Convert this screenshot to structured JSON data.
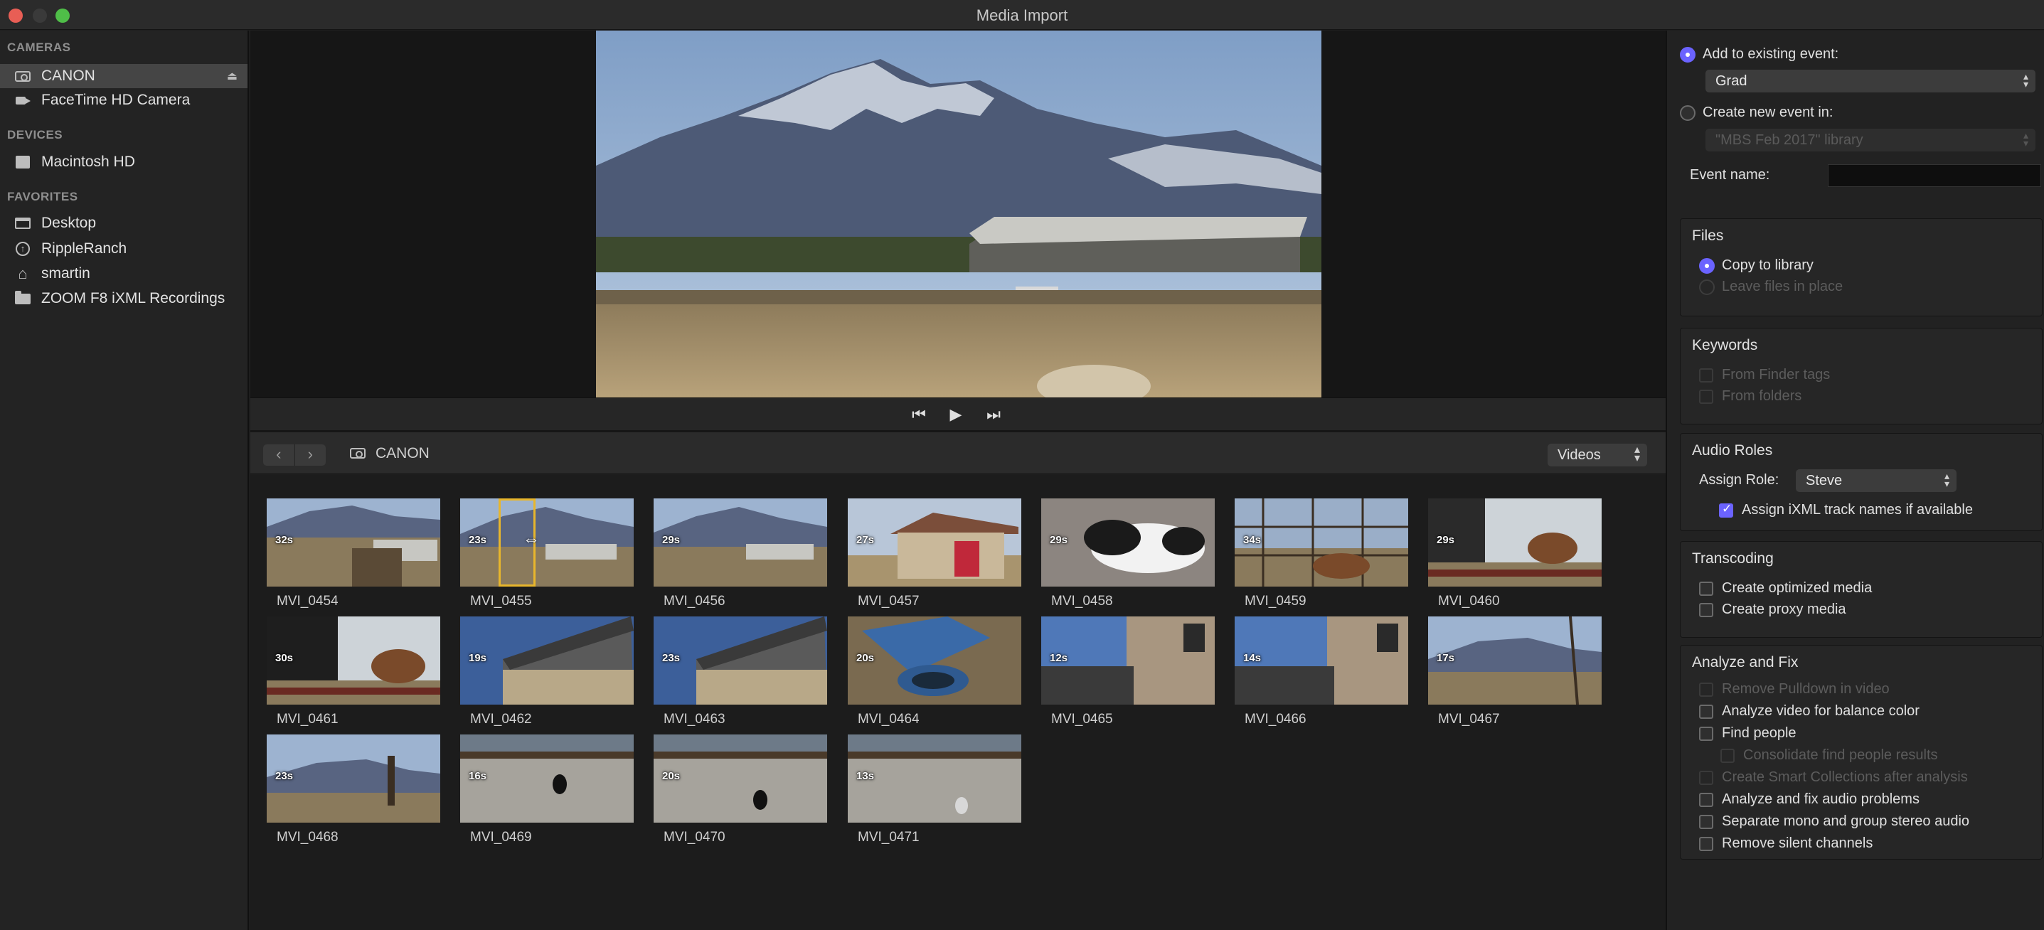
{
  "window": {
    "title": "Media Import"
  },
  "sidebar": {
    "sections": [
      {
        "title": "CAMERAS"
      },
      {
        "title": "DEVICES"
      },
      {
        "title": "FAVORITES"
      }
    ],
    "items": [
      {
        "label": "CANON",
        "icon": "camera-icon"
      },
      {
        "label": "FaceTime HD Camera",
        "icon": "video-camera-icon"
      },
      {
        "label": "Macintosh HD",
        "icon": "hard-drive-icon"
      },
      {
        "label": "Desktop",
        "icon": "desktop-icon"
      },
      {
        "label": "RippleRanch",
        "icon": "shared-drive-icon"
      },
      {
        "label": "smartin",
        "icon": "home-icon"
      },
      {
        "label": "ZOOM F8 iXML Recordings",
        "icon": "folder-icon"
      }
    ],
    "eject_glyph": "⏏"
  },
  "transport": {
    "prev": "⏮",
    "play": "▶",
    "next": "⏭"
  },
  "browser": {
    "back": "‹",
    "forward": "›",
    "location": "CANON",
    "filter": "Videos",
    "clips": [
      {
        "name": "MVI_0454",
        "duration": "32s"
      },
      {
        "name": "MVI_0455",
        "duration": "23s"
      },
      {
        "name": "MVI_0456",
        "duration": "29s"
      },
      {
        "name": "MVI_0457",
        "duration": "27s"
      },
      {
        "name": "MVI_0458",
        "duration": "29s"
      },
      {
        "name": "MVI_0459",
        "duration": "34s"
      },
      {
        "name": "MVI_0460",
        "duration": "29s"
      },
      {
        "name": "MVI_0461",
        "duration": "30s"
      },
      {
        "name": "MVI_0462",
        "duration": "19s"
      },
      {
        "name": "MVI_0463",
        "duration": "23s"
      },
      {
        "name": "MVI_0464",
        "duration": "20s"
      },
      {
        "name": "MVI_0465",
        "duration": "12s"
      },
      {
        "name": "MVI_0466",
        "duration": "14s"
      },
      {
        "name": "MVI_0467",
        "duration": "17s"
      },
      {
        "name": "MVI_0468",
        "duration": "23s"
      },
      {
        "name": "MVI_0469",
        "duration": "16s"
      },
      {
        "name": "MVI_0470",
        "duration": "20s"
      },
      {
        "name": "MVI_0471",
        "duration": "13s"
      }
    ]
  },
  "inspector": {
    "event": {
      "add_existing_label": "Add to existing event:",
      "existing_event": "Grad",
      "create_new_label": "Create new event in:",
      "library": "\"MBS Feb 2017\" library",
      "event_name_label": "Event name:",
      "event_name_value": ""
    },
    "files": {
      "title": "Files",
      "copy": "Copy to library",
      "leave": "Leave files in place"
    },
    "keywords": {
      "title": "Keywords",
      "finder_tags": "From Finder tags",
      "folders": "From folders"
    },
    "audio_roles": {
      "title": "Audio Roles",
      "assign_label": "Assign Role:",
      "role": "Steve",
      "ixml": "Assign iXML track names if available"
    },
    "transcoding": {
      "title": "Transcoding",
      "optimized": "Create optimized media",
      "proxy": "Create proxy media"
    },
    "analyze": {
      "title": "Analyze and Fix",
      "pulldown": "Remove Pulldown in video",
      "balance": "Analyze video for balance color",
      "find_people": "Find people",
      "consolidate": "Consolidate find people results",
      "smart_collections": "Create Smart Collections after analysis",
      "audio_problems": "Analyze and fix audio problems",
      "mono_stereo": "Separate mono and group stereo audio",
      "silent": "Remove silent channels"
    }
  }
}
